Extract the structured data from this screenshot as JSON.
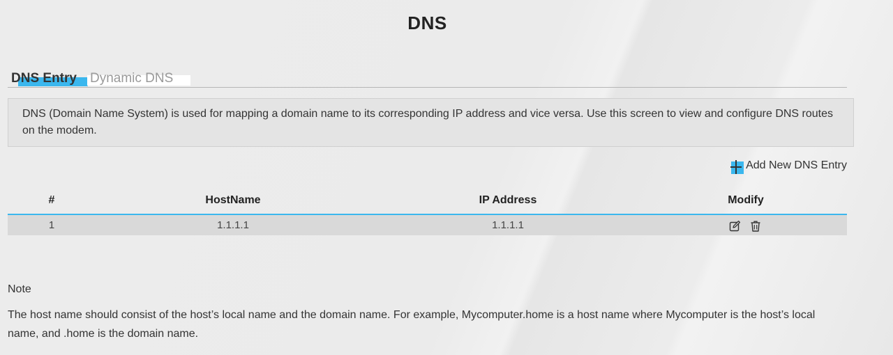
{
  "page": {
    "title": "DNS"
  },
  "tabs": [
    {
      "label": "DNS Entry",
      "active": true
    },
    {
      "label": "Dynamic DNS",
      "active": false
    }
  ],
  "info": {
    "text": "DNS (Domain Name System) is used for mapping a domain name to its corresponding IP address and vice versa. Use this screen to view and configure DNS routes on the modem."
  },
  "actions": {
    "add_label": "Add New DNS Entry",
    "add_icon": "plus-icon"
  },
  "table": {
    "columns": [
      "#",
      "HostName",
      "IP Address",
      "Modify"
    ],
    "rows": [
      {
        "index": "1",
        "hostname": "1.1.1.1",
        "ip": "1.1.1.1",
        "modify_icons": [
          "edit-icon",
          "trash-icon"
        ]
      }
    ]
  },
  "note": {
    "title": "Note",
    "text": "The host name should consist of the host’s local name and the domain name. For example, Mycomputer.home is a host name where Mycomputer is the host’s local name, and .home is the domain name."
  },
  "colors": {
    "accent": "#3bb7ee",
    "row_bg": "#d9d9d9",
    "info_bg": "#e4e4e4"
  }
}
